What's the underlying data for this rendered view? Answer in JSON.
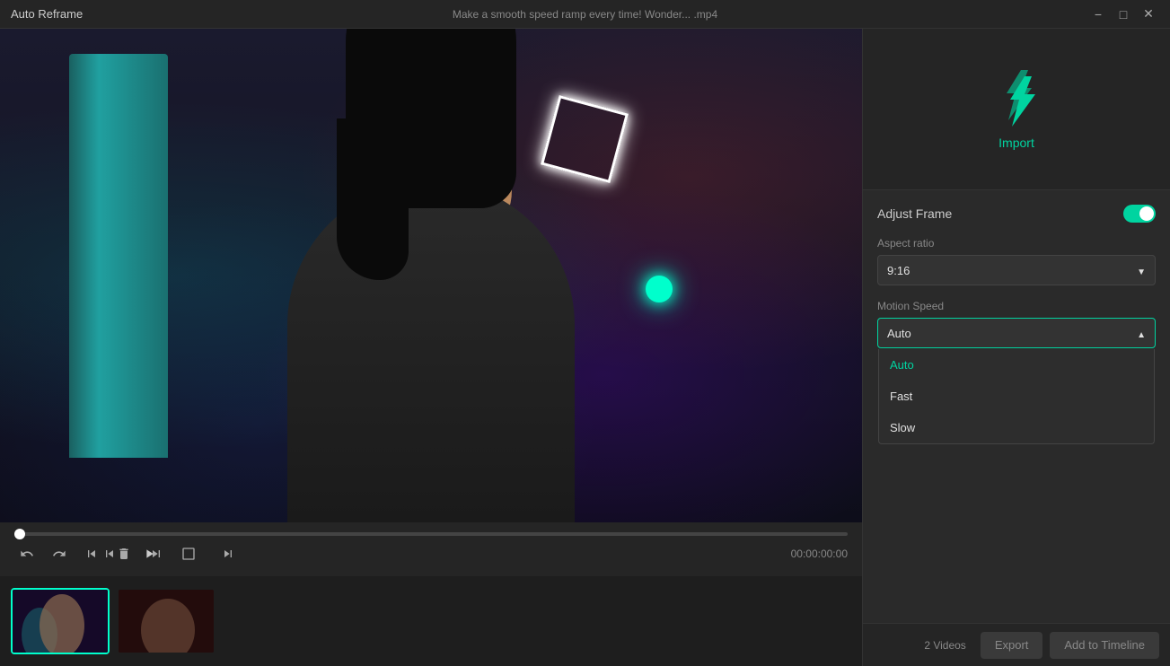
{
  "titlebar": {
    "app_name": "Auto Reframe",
    "file_name": "Make a smooth speed ramp every time!  Wonder... .mp4",
    "minimize_label": "−",
    "maximize_label": "□",
    "close_label": "✕"
  },
  "right_panel": {
    "import_label": "Import",
    "adjust_frame_label": "Adjust Frame",
    "aspect_ratio_label": "Aspect ratio",
    "aspect_ratio_value": "9:16",
    "motion_speed_label": "Motion Speed",
    "motion_speed_value": "Auto",
    "dropdown_options": [
      {
        "label": "Auto",
        "value": "auto"
      },
      {
        "label": "Fast",
        "value": "fast"
      },
      {
        "label": "Slow",
        "value": "slow"
      }
    ]
  },
  "playback": {
    "time": "00:00:00:00"
  },
  "bottom_bar": {
    "video_count": "2 Videos",
    "export_label": "Export",
    "add_timeline_label": "Add to Timeline"
  },
  "controls": {
    "undo_icon": "undo",
    "redo_icon": "redo",
    "skip_back_icon": "skip-back",
    "delete_icon": "delete",
    "skip_forward_icon": "skip-forward",
    "frame_back_icon": "frame-back",
    "play_icon": "play",
    "fit_icon": "fit",
    "frame_forward_icon": "frame-forward"
  }
}
